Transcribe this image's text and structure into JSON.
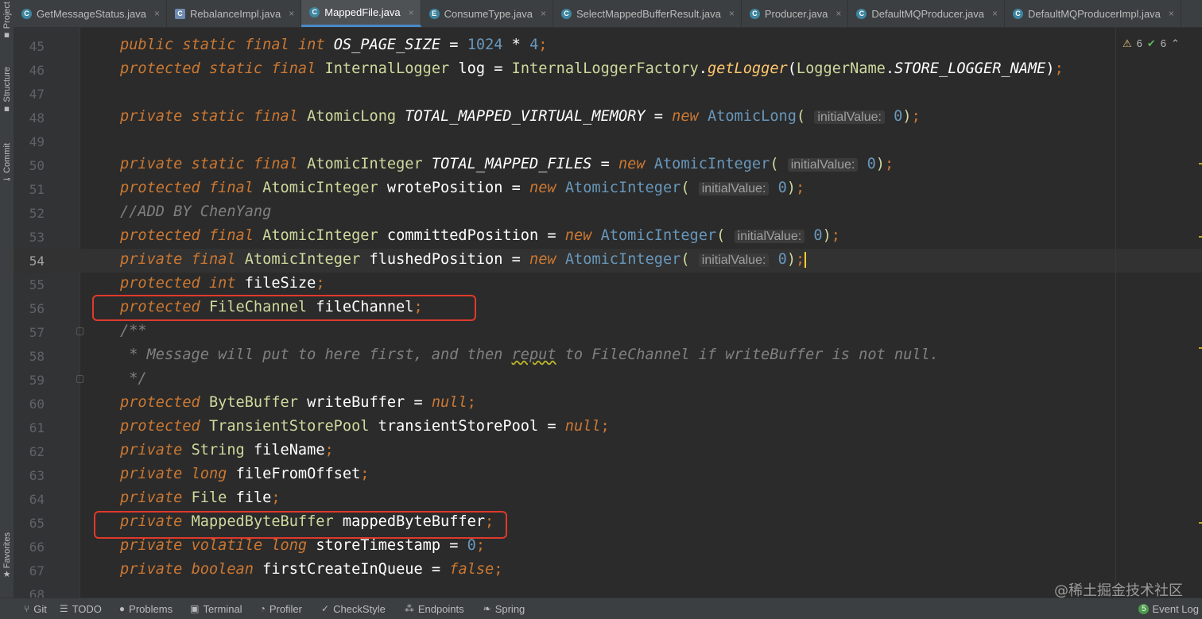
{
  "left_strip": {
    "project": "Project",
    "structure": "Structure",
    "commit": "Commit",
    "favorites": "Favorites"
  },
  "tabs": [
    {
      "label": "GetMessageStatus.java",
      "icon": "C",
      "active": false
    },
    {
      "label": "RebalanceImpl.java",
      "icon": "C",
      "active": false
    },
    {
      "label": "MappedFile.java",
      "icon": "C",
      "active": true
    },
    {
      "label": "ConsumeType.java",
      "icon": "E",
      "active": false
    },
    {
      "label": "SelectMappedBufferResult.java",
      "icon": "C",
      "active": false
    },
    {
      "label": "Producer.java",
      "icon": "C",
      "active": false
    },
    {
      "label": "DefaultMQProducer.java",
      "icon": "C",
      "active": false
    },
    {
      "label": "DefaultMQProducerImpl.java",
      "icon": "C",
      "active": false
    }
  ],
  "inspections": {
    "warnings": "6",
    "weak_warnings": "6"
  },
  "editor": {
    "line_numbers": [
      "45",
      "46",
      "47",
      "48",
      "49",
      "50",
      "51",
      "52",
      "53",
      "54",
      "55",
      "56",
      "57",
      "58",
      "59",
      "60",
      "61",
      "62",
      "63",
      "64",
      "65",
      "66",
      "67",
      "68"
    ],
    "current_line": "54",
    "lines": {
      "l45": {
        "kw1": "public",
        "kw2": "static",
        "kw3": "final",
        "kw4": "int",
        "field": "OS_PAGE_SIZE",
        "eq": "=",
        "n1": "1024",
        "op": "*",
        "n2": "4",
        "semi": ";"
      },
      "l46": {
        "kw1": "protected",
        "kw2": "static",
        "kw3": "final",
        "type": "InternalLogger",
        "name": "log",
        "eq": "=",
        "cls": "InternalLoggerFactory",
        "dot": ".",
        "fn": "getLogger",
        "lp": "(",
        "cls2": "LoggerName",
        "dot2": ".",
        "field": "STORE_LOGGER_NAME",
        "rp": ")",
        "semi": ";"
      },
      "l48": {
        "kw1": "private",
        "kw2": "static",
        "kw3": "final",
        "type": "AtomicLong",
        "field": "TOTAL_MAPPED_VIRTUAL_MEMORY",
        "eq": "=",
        "new": "new",
        "cls": "AtomicLong",
        "lp": "(",
        "hint": "initialValue:",
        "num": "0",
        "rp": ")",
        "semi": ";"
      },
      "l50": {
        "kw1": "private",
        "kw2": "static",
        "kw3": "final",
        "type": "AtomicInteger",
        "field": "TOTAL_MAPPED_FILES",
        "eq": "=",
        "new": "new",
        "cls": "AtomicInteger",
        "lp": "(",
        "hint": "initialValue:",
        "num": "0",
        "rp": ")",
        "semi": ";"
      },
      "l51": {
        "kw1": "protected",
        "kw2": "final",
        "type": "AtomicInteger",
        "name": "wrotePosition",
        "eq": "=",
        "new": "new",
        "cls": "AtomicInteger",
        "lp": "(",
        "hint": "initialValue:",
        "num": "0",
        "rp": ")",
        "semi": ";"
      },
      "l52": {
        "comment": "//ADD BY ChenYang"
      },
      "l53": {
        "kw1": "protected",
        "kw2": "final",
        "type": "AtomicInteger",
        "name": "committedPosition",
        "eq": "=",
        "new": "new",
        "cls": "AtomicInteger",
        "lp": "(",
        "hint": "initialValue:",
        "num": "0",
        "rp": ")",
        "semi": ";"
      },
      "l54": {
        "kw1": "private",
        "kw2": "final",
        "type": "AtomicInteger",
        "name": "flushedPosition",
        "eq": "=",
        "new": "new",
        "cls": "AtomicInteger",
        "lp": "(",
        "hint": "initialValue:",
        "num": "0",
        "rp": ")",
        "semi": ";"
      },
      "l55": {
        "kw1": "protected",
        "kw2": "int",
        "name": "fileSize",
        "semi": ";"
      },
      "l56": {
        "kw1": "protected",
        "type": "FileChannel",
        "name": "fileChannel",
        "semi": ";"
      },
      "l57": {
        "comment": "/**"
      },
      "l58": {
        "c1": " * Message will put to here first, and then ",
        "c2": "reput",
        "c3": " to FileChannel if writeBuffer is not null."
      },
      "l59": {
        "comment": " */"
      },
      "l60": {
        "kw1": "protected",
        "type": "ByteBuffer",
        "name": "writeBuffer",
        "eq": "=",
        "val": "null",
        "semi": ";"
      },
      "l61": {
        "kw1": "protected",
        "type": "TransientStorePool",
        "name": "transientStorePool",
        "eq": "=",
        "val": "null",
        "semi": ";"
      },
      "l62": {
        "kw1": "private",
        "type": "String",
        "name": "fileName",
        "semi": ";"
      },
      "l63": {
        "kw1": "private",
        "kw2": "long",
        "name": "fileFromOffset",
        "semi": ";"
      },
      "l64": {
        "kw1": "private",
        "type": "File",
        "name": "file",
        "semi": ";"
      },
      "l65": {
        "kw1": "private",
        "type": "MappedByteBuffer",
        "name": "mappedByteBuffer",
        "semi": ";"
      },
      "l66": {
        "kw1": "private",
        "kw2": "volatile",
        "kw3": "long",
        "name": "storeTimestamp",
        "eq": "=",
        "num": "0",
        "semi": ";"
      },
      "l67": {
        "kw1": "private",
        "kw2": "boolean",
        "name": "firstCreateInQueue",
        "eq": "=",
        "val": "false",
        "semi": ";"
      }
    }
  },
  "bottom_bar": {
    "items": [
      {
        "label": "Git",
        "icon": "git-branch-icon"
      },
      {
        "label": "TODO",
        "icon": "list-icon"
      },
      {
        "label": "Problems",
        "icon": "problems-icon"
      },
      {
        "label": "Terminal",
        "icon": "terminal-icon"
      },
      {
        "label": "Profiler",
        "icon": "profiler-icon"
      },
      {
        "label": "CheckStyle",
        "icon": "checkstyle-icon"
      },
      {
        "label": "Endpoints",
        "icon": "endpoints-icon"
      },
      {
        "label": "Spring",
        "icon": "spring-icon"
      }
    ],
    "event_log": "Event Log",
    "event_count": "5"
  },
  "watermark": "@稀土掘金技术社区",
  "colors": {
    "keyword": "#cc7832",
    "class": "#cfd99d",
    "number": "#6897bb",
    "method": "#ffc66d",
    "comment": "#808080",
    "highlight_box": "#e0392b"
  }
}
